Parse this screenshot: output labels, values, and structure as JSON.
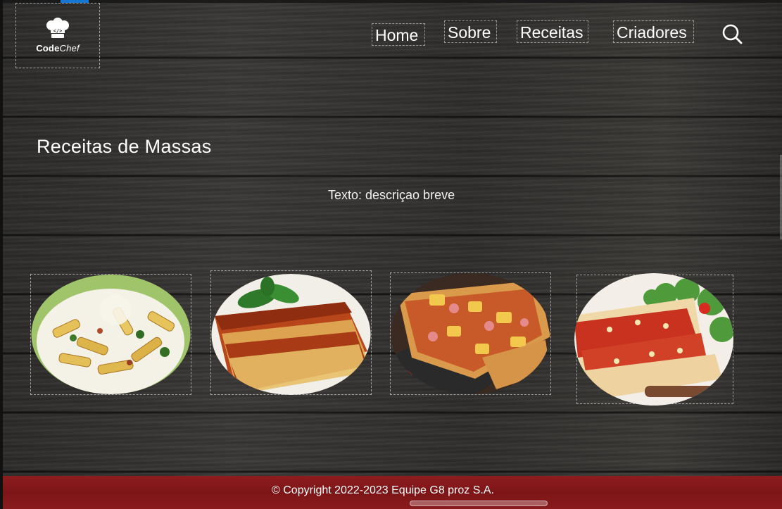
{
  "logo": {
    "code_tag": "</>",
    "brand_bold": "Code",
    "brand_italic": "Chef",
    "icon": "chef-hat-icon"
  },
  "nav": {
    "items": [
      {
        "label": "Home"
      },
      {
        "label": "Sobre"
      },
      {
        "label": "Receitas"
      },
      {
        "label": "Criadores"
      }
    ],
    "search_icon": "search-icon"
  },
  "main": {
    "title": "Receitas de Massas",
    "description": "Texto: descriçao breve"
  },
  "recipes": [
    {
      "name": "penne-pasta",
      "icon": "penne-dish-image"
    },
    {
      "name": "lasagna",
      "icon": "lasagna-dish-image"
    },
    {
      "name": "pizza",
      "icon": "pizza-dish-image"
    },
    {
      "name": "cannelloni",
      "icon": "cannelloni-dish-image"
    }
  ],
  "footer": {
    "copyright": "© Copyright 2022-2023 Equipe G8 proz S.A."
  },
  "colors": {
    "footer_red": "#8a1b1d",
    "accent_blue": "#1677d2",
    "text": "#ffffff"
  }
}
